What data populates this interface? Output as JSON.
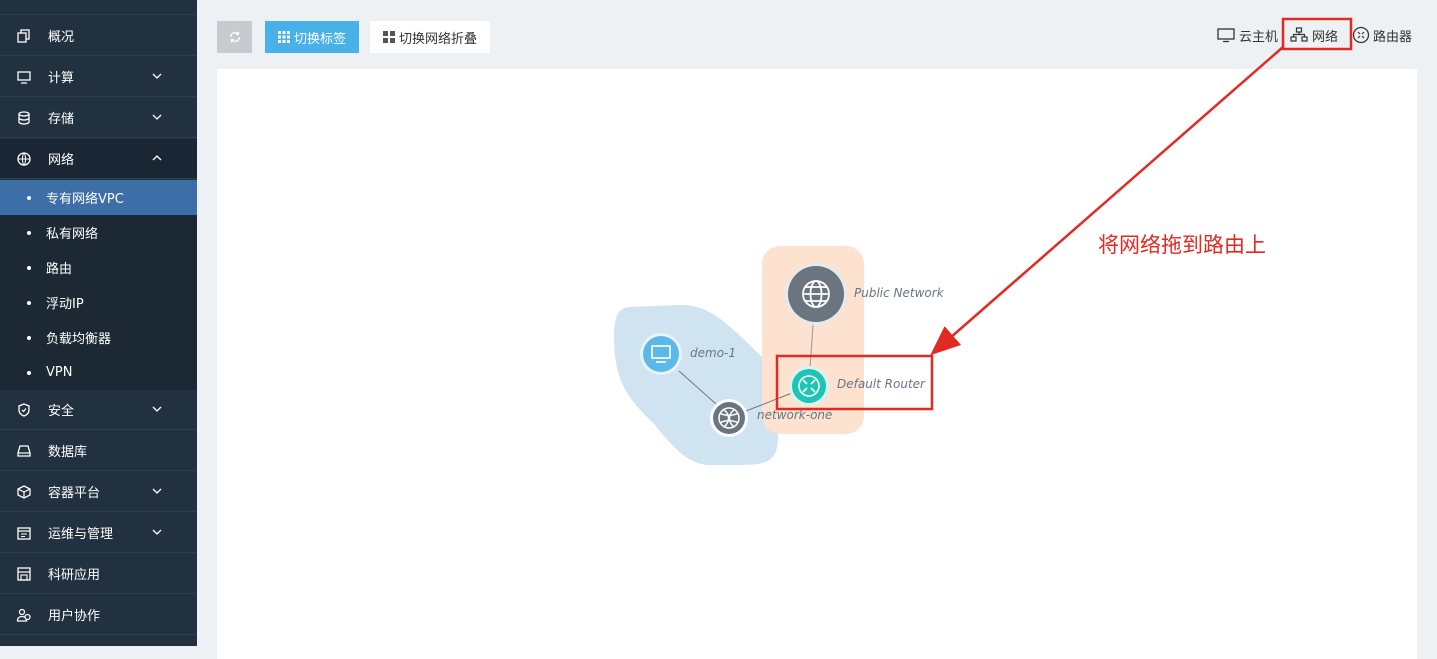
{
  "sidebar": {
    "items": [
      {
        "label": "概况",
        "icon": "copy-icon"
      },
      {
        "label": "计算",
        "icon": "monitor-icon"
      },
      {
        "label": "存储",
        "icon": "database-icon"
      },
      {
        "label": "网络",
        "icon": "globe-icon"
      },
      {
        "label": "安全",
        "icon": "shield-icon"
      },
      {
        "label": "数据库",
        "icon": "drive-icon"
      },
      {
        "label": "容器平台",
        "icon": "cube-icon"
      },
      {
        "label": "运维与管理",
        "icon": "calendar-icon"
      },
      {
        "label": "科研应用",
        "icon": "store-icon"
      },
      {
        "label": "用户协作",
        "icon": "users-icon"
      }
    ],
    "network_sub_items": [
      {
        "label": "专有网络VPC",
        "active": true
      },
      {
        "label": "私有网络"
      },
      {
        "label": "路由"
      },
      {
        "label": "浮动IP"
      },
      {
        "label": "负载均衡器"
      },
      {
        "label": "VPN"
      }
    ]
  },
  "toolbar": {
    "refresh_icon": "refresh-icon",
    "tab_toggle_label": "切换标签",
    "collapse_label": "切换网络折叠"
  },
  "legend": {
    "vm_label": "云主机",
    "network_label": "网络",
    "router_label": "路由器"
  },
  "topology": {
    "nodes": {
      "vm": "demo-1",
      "public_network": "Public Network",
      "router": "Default Router",
      "network": "network-one"
    }
  },
  "annotation": {
    "text": "将网络拖到路由上",
    "color": "#e02a22"
  },
  "colors": {
    "sidebar_bg": "#22313f",
    "active_item": "#3d6ea8",
    "primary_button": "#48b2e8",
    "router_node": "#1cc5b4",
    "vm_node": "#5cb8e6",
    "network_node": "#6b7580"
  }
}
